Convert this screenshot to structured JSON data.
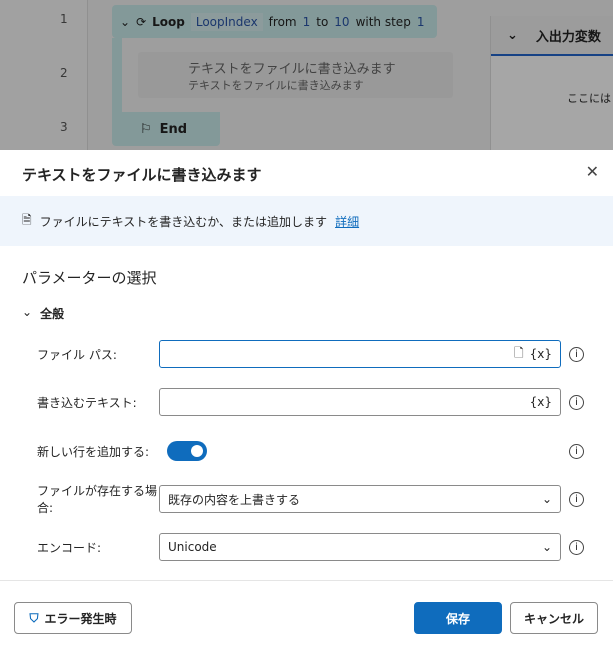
{
  "flow": {
    "lines": [
      "1",
      "2",
      "3"
    ],
    "loop": {
      "label": "Loop",
      "var": "LoopIndex",
      "from_text": "from",
      "from": "1",
      "to_text": "to",
      "to": "10",
      "step_text": "with step",
      "step": "1"
    },
    "action": {
      "title": "テキストをファイルに書き込みます",
      "subtitle": "テキストをファイルに書き込みます"
    },
    "end": "End"
  },
  "variables": {
    "title": "入出力変数",
    "empty": "ここにはま"
  },
  "dialog": {
    "title": "テキストをファイルに書き込みます",
    "description": "ファイルにテキストを書き込むか、または追加します",
    "details_link": "詳細",
    "section": "パラメーターの選択",
    "group": "全般",
    "fields": {
      "file_path": {
        "label": "ファイル パス:",
        "value": "",
        "var_icon": "{x}"
      },
      "text": {
        "label": "書き込むテキスト:",
        "value": "",
        "var_icon": "{x}"
      },
      "newline": {
        "label": "新しい行を追加する:",
        "value": true
      },
      "if_exists": {
        "label": "ファイルが存在する場合:",
        "value": "既存の内容を上書きする"
      },
      "encoding": {
        "label": "エンコード:",
        "value": "Unicode"
      }
    },
    "on_error": "エラー発生時",
    "save": "保存",
    "cancel": "キャンセル"
  },
  "colors": {
    "accent": "#0f6cbd",
    "loop_bg": "#c9eceb"
  }
}
